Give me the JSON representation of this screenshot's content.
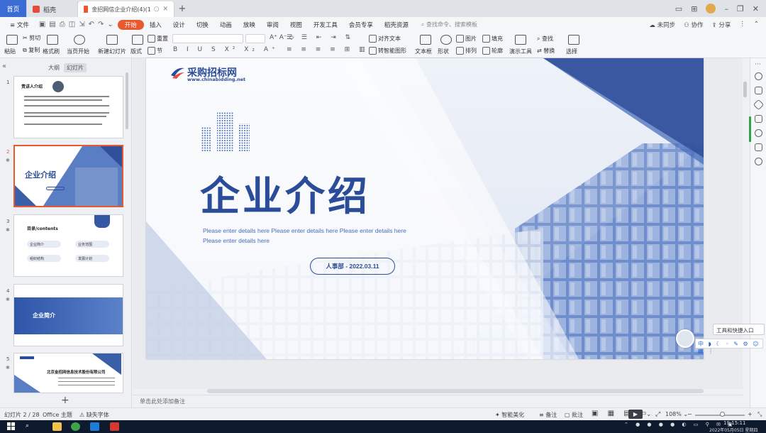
{
  "titlebar": {
    "tabs": [
      {
        "label": "首页"
      },
      {
        "label": "稻壳"
      },
      {
        "label": "金招网信企业介绍(4)(1)(1).pptx"
      }
    ],
    "new_tab": "+"
  },
  "menubar": {
    "file": "≡ 文件",
    "items": [
      "开始",
      "插入",
      "设计",
      "切换",
      "动画",
      "放映",
      "审阅",
      "视图",
      "开发工具",
      "会员专享",
      "稻壳资源"
    ],
    "active": "开始",
    "search": "查找命令、搜索模板",
    "right": [
      "未同步",
      "协作",
      "分享"
    ]
  },
  "ribbon": {
    "paste": "粘贴",
    "cut": "剪切",
    "copy": "复制",
    "format_painter": "格式刷",
    "play_from_current": "当页开始",
    "new_slide": "新建幻灯片",
    "layout": "版式",
    "section": "节",
    "reset": "重置",
    "text_direction": "对齐文本",
    "convert_smartart": "转智能图形",
    "textbox": "文本框",
    "shape": "形状",
    "arrange": "排列",
    "picture": "图片",
    "fill": "填充",
    "outline": "轮廓",
    "presenter_tools": "演示工具",
    "find": "查找",
    "replace": "替换",
    "select": "选择"
  },
  "leftpanel": {
    "tab_outline": "大纲",
    "tab_slides": "幻灯片",
    "slides": [
      {
        "num": "1",
        "title": "责讲人介绍"
      },
      {
        "num": "2",
        "title": "企业介绍"
      },
      {
        "num": "3",
        "title": "目录/contents",
        "items": [
          "企业简介",
          "业务范围",
          "组织结构",
          "发展计划"
        ]
      },
      {
        "num": "4",
        "title": "企业简介"
      },
      {
        "num": "5",
        "title": "北京金招网信息技术股份有限公司"
      }
    ],
    "add": "+"
  },
  "slide": {
    "brand_name": "采购招标网",
    "brand_url": "www.chinabidding.net",
    "title": "企业介绍",
    "body": "Please enter details here Please enter details here Please enter details here Please enter details here",
    "pill": "人事部 - 2022.03.11"
  },
  "notes_placeholder": "单击此处添加备注",
  "assistant": {
    "label": "工具和快捷入口"
  },
  "statusbar": {
    "slide_counter": "幻灯片 2 / 28",
    "theme": "Office 主题",
    "font_missing": "缺失字体",
    "smart_beautify": "智能美化",
    "notes": "备注",
    "comments": "批注",
    "zoom": "108%"
  },
  "taskbar": {
    "time": "19:15:11",
    "date": "2022年05月05日 星期四"
  },
  "colors": {
    "brand_blue": "#2b4d99",
    "accent_orange": "#e8592f",
    "slide_blue": "#4a6fbb"
  }
}
